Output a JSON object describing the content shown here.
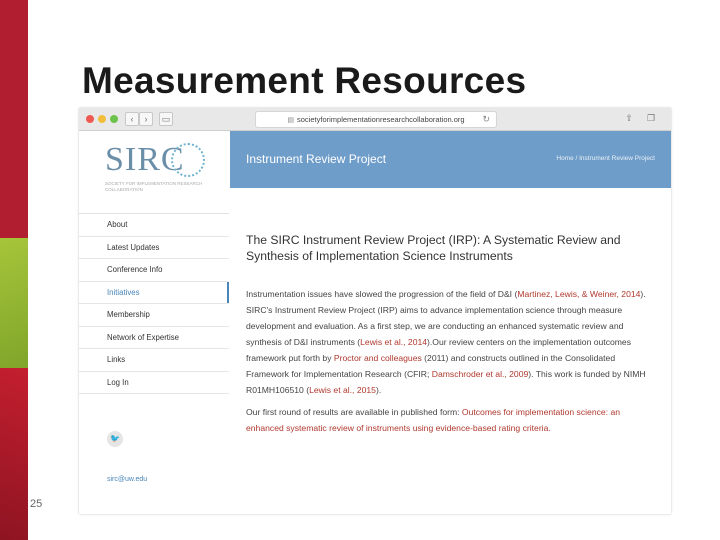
{
  "slide": {
    "title": "Measurement Resources",
    "page_number": "25"
  },
  "browser": {
    "url": "societyforimplementationresearchcollaboration.org",
    "back_icon": "chevron-left-icon",
    "forward_icon": "chevron-right-icon",
    "reload_icon": "reload-icon"
  },
  "site": {
    "logo_text": "SIRC",
    "logo_tagline": "SOCIETY FOR IMPLEMENTATION RESEARCH COLLABORATION",
    "nav": [
      {
        "label": "About"
      },
      {
        "label": "Latest Updates"
      },
      {
        "label": "Conference Info"
      },
      {
        "label": "Initiatives"
      },
      {
        "label": "Membership"
      },
      {
        "label": "Network of Expertise"
      },
      {
        "label": "Links"
      },
      {
        "label": "Log In"
      }
    ],
    "active_nav": "Initiatives",
    "email": "sirc@uw.edu",
    "banner": {
      "title": "Instrument Review Project",
      "breadcrumb": "Home / Instrument Review Project"
    },
    "content": {
      "heading": "The SIRC Instrument Review Project (IRP): A Systematic Review and Synthesis of Implementation Science Instruments",
      "p1": {
        "t1": "Instrumentation issues have slowed the progression of the field of D&I (",
        "l1": "Martinez, Lewis, & Weiner, 2014",
        "t2": "). SIRC's Instrument Review Project (IRP) aims to advance implementation science through measure development and evaluation. As a first step, we are conducting an enhanced systematic review and synthesis of D&I instruments (",
        "l2": "Lewis et al., 2014",
        "t3": ").Our review centers on the implementation outcomes framework put forth by ",
        "l3": "Proctor and colleagues",
        "t4": " (2011) and constructs outlined in the Consolidated Framework for Implementation Research (CFIR; ",
        "l4": "Damschroder et al., 2009",
        "t5": "). This work is funded by NIMH R01MH106510 (",
        "l5": "Lewis et al., 2015",
        "t6": ")."
      },
      "p2": {
        "t1": "Our first round of results are available in published form: ",
        "l1": "Outcomes for implementation science: an enhanced systematic review of instruments using evidence-based rating criteria."
      }
    }
  },
  "colors": {
    "brand_red": "#b01e2f",
    "brand_green": "#a6c53a",
    "banner_blue": "#6f9dc9",
    "link_red": "#b0382e"
  }
}
